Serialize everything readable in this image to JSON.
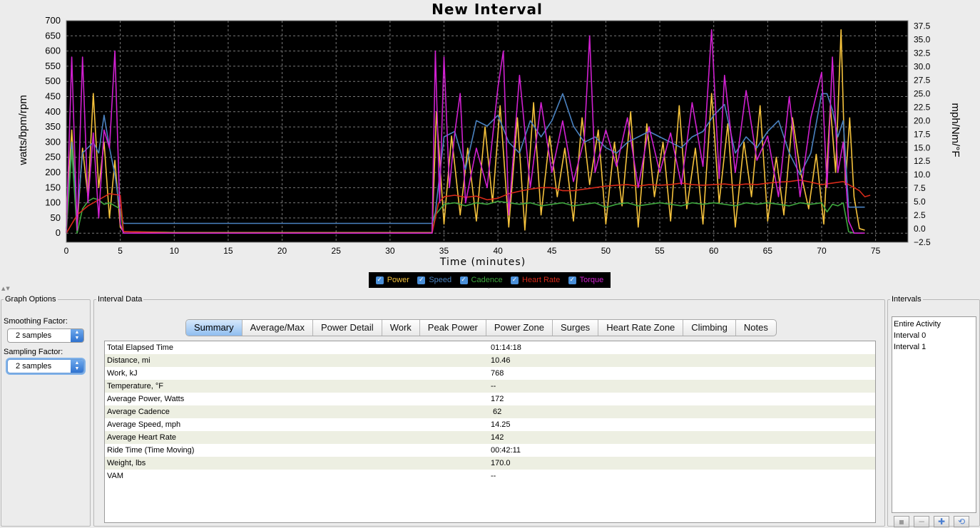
{
  "chart_data": {
    "type": "line",
    "title": "New Interval",
    "xlabel": "Time (minutes)",
    "ylabel": "watts/bpm/rpm",
    "y2label": "mph/Nm/°F",
    "xlim": [
      0,
      78
    ],
    "ylim": [
      -30,
      700
    ],
    "y2lim": [
      -2.5,
      38.5
    ],
    "xticks": [
      "0",
      "5",
      "10",
      "15",
      "20",
      "25",
      "30",
      "35",
      "40",
      "45",
      "50",
      "55",
      "60",
      "65",
      "70",
      "75"
    ],
    "yticks": [
      "700",
      "650",
      "600",
      "550",
      "500",
      "450",
      "400",
      "350",
      "300",
      "250",
      "200",
      "150",
      "100",
      "50",
      "0"
    ],
    "y2ticks": [
      "37.5",
      "35.0",
      "32.5",
      "30.0",
      "27.5",
      "25.0",
      "22.5",
      "20.0",
      "17.5",
      "15.0",
      "12.5",
      "10.0",
      "7.5",
      "5.0",
      "2.5",
      "0.0",
      "−2.5"
    ],
    "grid": true,
    "series": [
      {
        "name": "Power",
        "color": "#f5c23c",
        "axis": "left",
        "x": [
          0,
          0.5,
          1,
          1.5,
          2,
          2.5,
          3,
          3.5,
          4,
          4.5,
          5,
          5.3,
          10,
          20,
          30,
          33.9,
          34.3,
          35,
          35.7,
          36.5,
          37.2,
          38,
          38.8,
          39.5,
          40.2,
          41,
          41.8,
          42.5,
          43.3,
          44,
          44.8,
          45.5,
          46.2,
          47,
          47.8,
          48.5,
          49.3,
          50,
          50.8,
          51.5,
          52.3,
          53,
          53.8,
          54.5,
          55.3,
          56,
          56.8,
          57.5,
          58.3,
          59,
          59.8,
          60.5,
          61.3,
          62,
          62.8,
          63.5,
          64.3,
          65,
          65.8,
          66.5,
          67.3,
          68,
          68.8,
          69.5,
          70.2,
          70.8,
          71.3,
          71.8,
          72.2,
          72.6,
          73,
          73.5,
          74
        ],
        "y": [
          60,
          340,
          20,
          280,
          120,
          460,
          150,
          300,
          50,
          240,
          20,
          5,
          2,
          2,
          2,
          2,
          400,
          30,
          320,
          60,
          280,
          40,
          350,
          100,
          420,
          20,
          380,
          10,
          430,
          60,
          320,
          120,
          280,
          40,
          380,
          160,
          340,
          30,
          300,
          90,
          400,
          20,
          360,
          120,
          300,
          40,
          420,
          80,
          280,
          30,
          460,
          100,
          360,
          20,
          300,
          120,
          420,
          40,
          250,
          60,
          380,
          210,
          80,
          260,
          30,
          420,
          200,
          670,
          160,
          380,
          120,
          15,
          10
        ]
      },
      {
        "name": "Speed",
        "color": "#4a82c0",
        "axis": "right",
        "x": [
          0,
          0.5,
          1,
          1.5,
          2,
          2.5,
          3,
          3.5,
          4,
          4.5,
          5,
          5.3,
          10,
          20,
          30,
          33.9,
          34.2,
          35,
          36,
          37,
          38,
          39,
          40,
          41,
          42,
          43,
          44,
          45,
          46,
          47,
          48,
          49,
          50,
          51,
          52,
          53,
          54,
          55,
          56,
          57,
          58,
          59,
          60,
          61,
          62,
          63,
          64,
          65,
          66,
          67,
          68,
          69,
          70,
          70.5,
          71,
          71.5,
          72,
          72.5,
          73,
          73.5,
          74
        ],
        "y": [
          0,
          16,
          2,
          14,
          15,
          16,
          14,
          21,
          15,
          10,
          3,
          1,
          1,
          1,
          1,
          1,
          3,
          17,
          18,
          11,
          20,
          19,
          21,
          16,
          14,
          20,
          17,
          20,
          25,
          19,
          16,
          17,
          15,
          14,
          16,
          17,
          18,
          17,
          16,
          15,
          17,
          18,
          21,
          23,
          14,
          17,
          15,
          18,
          20,
          14,
          10,
          14,
          25,
          25,
          22,
          17,
          20,
          4,
          4,
          4,
          4
        ]
      },
      {
        "name": "Cadence",
        "color": "#3ea83e",
        "axis": "left",
        "x": [
          0,
          0.5,
          1,
          1.5,
          2,
          2.5,
          3,
          3.5,
          4,
          4.5,
          5,
          5.3,
          10,
          20,
          30,
          33.9,
          34.2,
          35,
          36,
          37,
          38,
          39,
          40,
          41,
          42,
          43,
          44,
          45,
          46,
          47,
          48,
          49,
          50,
          51,
          52,
          53,
          54,
          55,
          56,
          57,
          58,
          59,
          60,
          61,
          62,
          63,
          64,
          65,
          66,
          67,
          68,
          69,
          70,
          70.5,
          71,
          71.5,
          72,
          72.5,
          73,
          73.5,
          74
        ],
        "y": [
          0,
          275,
          0,
          80,
          105,
          115,
          110,
          95,
          100,
          90,
          80,
          0,
          0,
          0,
          0,
          0,
          60,
          95,
          100,
          90,
          100,
          95,
          105,
          100,
          95,
          100,
          90,
          95,
          100,
          90,
          95,
          100,
          85,
          95,
          100,
          90,
          95,
          100,
          95,
          90,
          100,
          95,
          100,
          95,
          90,
          100,
          95,
          100,
          95,
          90,
          100,
          95,
          100,
          70,
          95,
          90,
          100,
          5,
          0,
          0,
          0
        ]
      },
      {
        "name": "Heart Rate",
        "color": "#d82a1a",
        "axis": "left",
        "x": [
          0,
          1,
          2,
          3,
          4,
          5,
          5.3,
          10,
          20,
          30,
          33.9,
          34.5,
          35,
          36,
          37,
          38,
          39,
          40,
          41,
          42,
          43,
          44,
          45,
          46,
          47,
          48,
          49,
          50,
          51,
          52,
          53,
          54,
          55,
          56,
          57,
          58,
          59,
          60,
          61,
          62,
          63,
          64,
          65,
          66,
          67,
          68,
          69,
          70,
          71,
          72,
          72.5,
          73,
          73.5,
          74,
          74.5
        ],
        "y": [
          0,
          60,
          90,
          110,
          130,
          125,
          5,
          0,
          0,
          0,
          0,
          100,
          120,
          125,
          118,
          122,
          110,
          115,
          130,
          138,
          145,
          150,
          150,
          140,
          140,
          145,
          150,
          155,
          158,
          160,
          155,
          160,
          158,
          160,
          165,
          160,
          158,
          160,
          162,
          158,
          162,
          160,
          165,
          168,
          170,
          175,
          168,
          160,
          165,
          170,
          160,
          150,
          140,
          120,
          125
        ]
      },
      {
        "name": "Torque",
        "color": "#d020d0",
        "axis": "left",
        "x": [
          0,
          0.5,
          1,
          1.5,
          2,
          2.5,
          3,
          3.5,
          4,
          4.5,
          5,
          5.3,
          10,
          20,
          30,
          33.9,
          34.2,
          34.6,
          35,
          35.5,
          36,
          36.5,
          37,
          38,
          39,
          40,
          40.5,
          41,
          42,
          43,
          44,
          45,
          46,
          47,
          48,
          48.5,
          49,
          50,
          51,
          52,
          53,
          54,
          55,
          56,
          57,
          58,
          59,
          59.8,
          60.5,
          61,
          62,
          63,
          64,
          65,
          66,
          67,
          68,
          69,
          70,
          70.5,
          71,
          71.5,
          72,
          72.5,
          73,
          74
        ],
        "y": [
          0,
          580,
          10,
          580,
          100,
          330,
          50,
          340,
          280,
          600,
          30,
          0,
          0,
          0,
          0,
          0,
          600,
          100,
          580,
          150,
          330,
          460,
          100,
          280,
          150,
          480,
          600,
          60,
          520,
          150,
          430,
          200,
          370,
          170,
          310,
          650,
          200,
          340,
          220,
          380,
          150,
          350,
          200,
          330,
          160,
          430,
          220,
          670,
          180,
          520,
          200,
          470,
          240,
          320,
          120,
          450,
          120,
          380,
          530,
          150,
          580,
          200,
          300,
          40,
          0,
          0
        ]
      }
    ]
  },
  "legend": {
    "items": [
      {
        "label": "Power",
        "color": "#f5c23c"
      },
      {
        "label": "Speed",
        "color": "#4a82c0"
      },
      {
        "label": "Cadence",
        "color": "#3ea83e"
      },
      {
        "label": "Heart Rate",
        "color": "#d82a1a"
      },
      {
        "label": "Torque",
        "color": "#d020d0"
      }
    ]
  },
  "graph_options": {
    "title": "Graph Options",
    "smoothing_label": "Smoothing Factor:",
    "smoothing_value": "2 samples",
    "sampling_label": "Sampling Factor:",
    "sampling_value": "2 samples"
  },
  "interval_data": {
    "title": "Interval Data",
    "tabs": [
      "Summary",
      "Average/Max",
      "Power Detail",
      "Work",
      "Peak Power",
      "Power Zone",
      "Surges",
      "Heart Rate Zone",
      "Climbing",
      "Notes"
    ],
    "active_tab": "Summary",
    "rows": [
      {
        "label": "Total Elapsed Time",
        "value": "01:14:18"
      },
      {
        "label": "Distance, mi",
        "value": "10.46"
      },
      {
        "label": "Work, kJ",
        "value": "768"
      },
      {
        "label": "Temperature, °F",
        "value": "--"
      },
      {
        "label": "Average Power, Watts",
        "value": "172"
      },
      {
        "label": "Average Cadence",
        "value": " 62"
      },
      {
        "label": "Average Speed, mph",
        "value": "14.25"
      },
      {
        "label": "Average Heart Rate",
        "value": "142"
      },
      {
        "label": "Ride Time (Time Moving)",
        "value": "00:42:11"
      },
      {
        "label": "Weight, lbs",
        "value": "170.0"
      },
      {
        "label": "VAM",
        "value": "--"
      }
    ]
  },
  "intervals": {
    "title": "Intervals",
    "items": [
      "Entire Activity",
      "Interval 0",
      "Interval 1"
    ],
    "buttons": [
      {
        "icon": "edit-interval-icon",
        "glyph": "▪",
        "enabled": false
      },
      {
        "icon": "minus-icon",
        "glyph": "−",
        "enabled": false
      },
      {
        "icon": "plus-icon",
        "glyph": "✚",
        "enabled": true
      },
      {
        "icon": "refresh-icon",
        "glyph": "⟲",
        "enabled": true
      }
    ]
  },
  "colors": {
    "plot_bg": "#000000",
    "grid": "#7a7a7a",
    "active_tab": "#8fbdf0"
  }
}
